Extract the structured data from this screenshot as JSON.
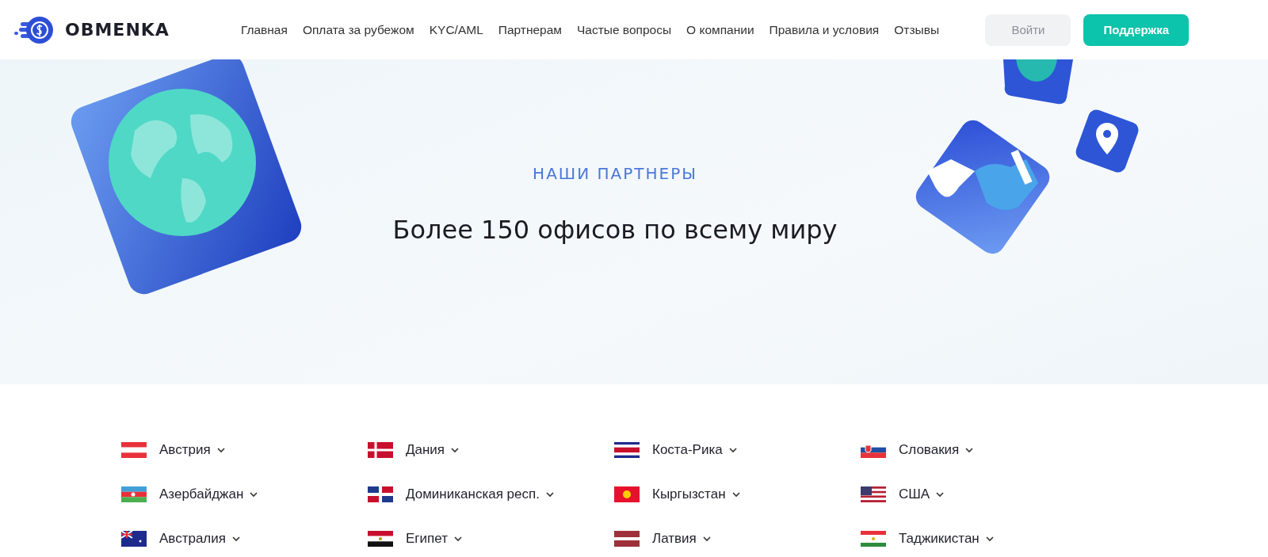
{
  "header": {
    "logo": "OBMENKA",
    "nav": [
      "Главная",
      "Оплата за рубежом",
      "KYC/AML",
      "Партнерам",
      "Частые вопросы",
      "О компании",
      "Правила и условия",
      "Отзывы"
    ],
    "login": "Войти",
    "support": "Поддержка"
  },
  "hero": {
    "eyebrow": "НАШИ ПАРТНЕРЫ",
    "title": "Более 150 офисов по всему миру"
  },
  "countries": [
    [
      "Австрия",
      "Азербайджан",
      "Австралия"
    ],
    [
      "Дания",
      "Доминиканская респ.",
      "Египет"
    ],
    [
      "Коста-Рика",
      "Кыргызстан",
      "Латвия"
    ],
    [
      "Словакия",
      "США",
      "Таджикистан"
    ]
  ]
}
